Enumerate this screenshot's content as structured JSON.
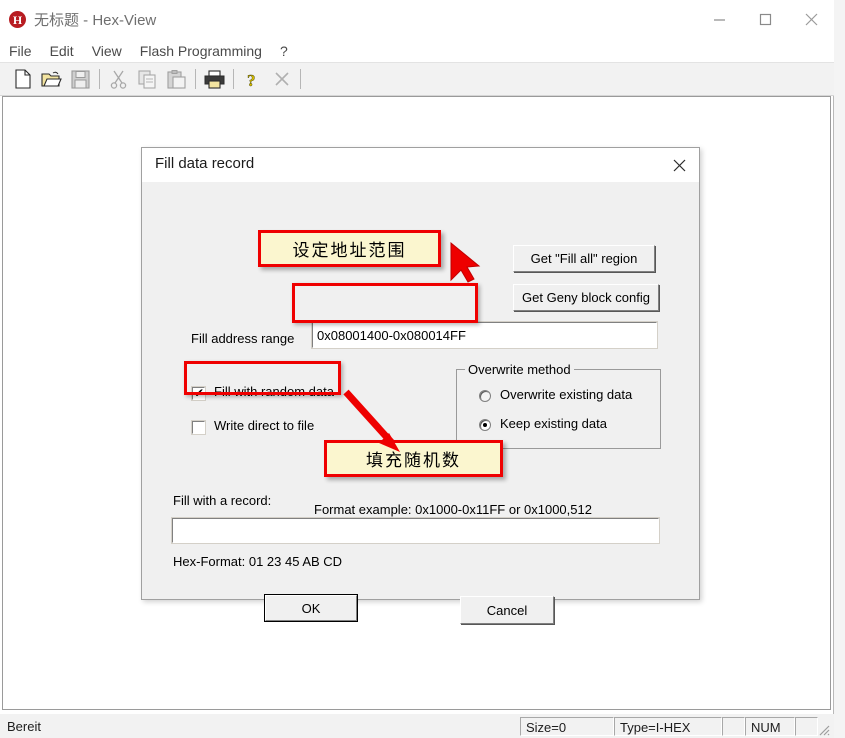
{
  "window": {
    "app_icon_letter": "H",
    "title": "无标题 - Hex-View",
    "controls": {
      "minimize": "minimize-icon",
      "maximize": "maximize-icon",
      "close": "close-icon"
    }
  },
  "menu": {
    "items": [
      "File",
      "Edit",
      "View",
      "Flash Programming",
      "?"
    ]
  },
  "toolbar": {
    "items": [
      {
        "name": "new-file-icon",
        "enabled": true
      },
      {
        "name": "open-file-icon",
        "enabled": true
      },
      {
        "name": "save-file-icon",
        "enabled": false
      },
      {
        "name": "cut-icon",
        "enabled": false
      },
      {
        "name": "copy-icon",
        "enabled": false
      },
      {
        "name": "paste-icon",
        "enabled": false
      },
      {
        "name": "print-icon",
        "enabled": true
      },
      {
        "name": "help-icon",
        "enabled": true
      },
      {
        "name": "close-document-icon",
        "enabled": false
      }
    ]
  },
  "dialog": {
    "title": "Fill data record",
    "close_icon": "close-icon",
    "buttons": {
      "get_fill_all_region": "Get \"Fill all\" region",
      "get_geny_block_config": "Get Geny block config",
      "ok": "OK",
      "cancel": "Cancel"
    },
    "address": {
      "label": "Fill address range",
      "value": "0x08001400-0x080014FF",
      "placeholder": "",
      "hint": "Format example: 0x1000-0x11FF or 0x1000,512"
    },
    "checkboxes": [
      {
        "label": "Fill with random data",
        "checked": true
      },
      {
        "label": "Write direct to file",
        "checked": false
      }
    ],
    "overwrite_method": {
      "title": "Overwrite method",
      "options": [
        {
          "label": "Overwrite existing data",
          "selected": false
        },
        {
          "label": "Keep existing data",
          "selected": true
        }
      ]
    },
    "record": {
      "label": "Fill with a record:",
      "value": "",
      "placeholder": "",
      "hint": "Hex-Format:  01 23 45 AB CD"
    }
  },
  "annotations": [
    {
      "text": "设定地址范围",
      "name": "annotation-set-address-range"
    },
    {
      "text": "填充随机数",
      "name": "annotation-fill-random-number"
    }
  ],
  "statusbar": {
    "message": "Bereit",
    "size": "Size=0",
    "type": "Type=I-HEX",
    "blank1": "",
    "num": "NUM",
    "blank2": ""
  },
  "colors": {
    "annotation_border": "#ef0000",
    "annotation_fill": "#fbf6cf",
    "app_icon": "#b81d22",
    "dialog_face": "#f0f0f0"
  }
}
